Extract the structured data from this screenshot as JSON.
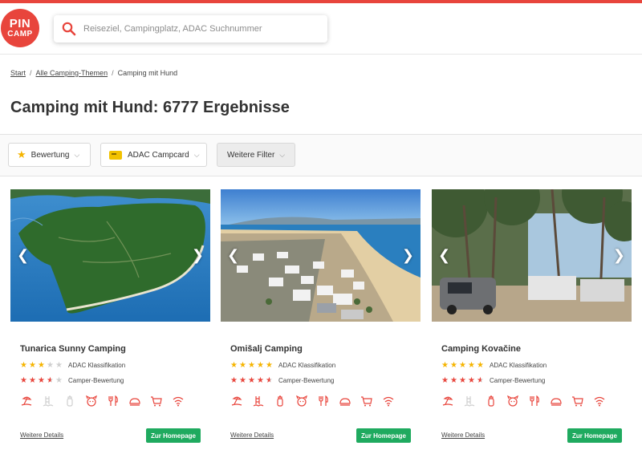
{
  "brand": {
    "logo_line1": "PIN",
    "logo_line2": "CAMP",
    "accent": "#e8453c"
  },
  "search": {
    "placeholder": "Reiseziel, Campingplatz, ADAC Suchnummer"
  },
  "breadcrumb": {
    "start": "Start",
    "themes": "Alle Camping-Themen",
    "current": "Camping mit Hund",
    "separator": "/"
  },
  "page_title": "Camping mit Hund: 6777 Ergebnisse",
  "filters": {
    "rating": "Bewertung",
    "campcard": "ADAC Campcard",
    "more": "Weitere Filter",
    "chevron": "⌵"
  },
  "labels": {
    "adac": "ADAC Klassifikation",
    "camper": "Camper-Bewertung",
    "details": "Weitere Details",
    "homepage": "Zur Homepage"
  },
  "cards": [
    {
      "name": "Tunarica Sunny Camping",
      "adac_stars": 3,
      "camper_rating": 3.5,
      "amenities": [
        "beach-icon",
        "pool-icon",
        "baby-bottle-icon",
        "dog-icon",
        "restaurant-icon",
        "bakery-icon",
        "shop-cart-icon",
        "wifi-icon"
      ],
      "amenity_active": [
        true,
        false,
        false,
        true,
        true,
        true,
        true,
        true
      ]
    },
    {
      "name": "Omišalj Camping",
      "adac_stars": 5,
      "camper_rating": 4.5,
      "amenities": [
        "beach-icon",
        "pool-icon",
        "baby-bottle-icon",
        "dog-icon",
        "restaurant-icon",
        "bakery-icon",
        "shop-cart-icon",
        "wifi-icon"
      ],
      "amenity_active": [
        true,
        true,
        true,
        true,
        true,
        true,
        true,
        true
      ]
    },
    {
      "name": "Camping Kovačine",
      "adac_stars": 5,
      "camper_rating": 4.5,
      "amenities": [
        "beach-icon",
        "pool-icon",
        "baby-bottle-icon",
        "dog-icon",
        "restaurant-icon",
        "bakery-icon",
        "shop-cart-icon",
        "wifi-icon"
      ],
      "amenity_active": [
        true,
        false,
        true,
        true,
        true,
        true,
        true,
        true
      ]
    }
  ]
}
